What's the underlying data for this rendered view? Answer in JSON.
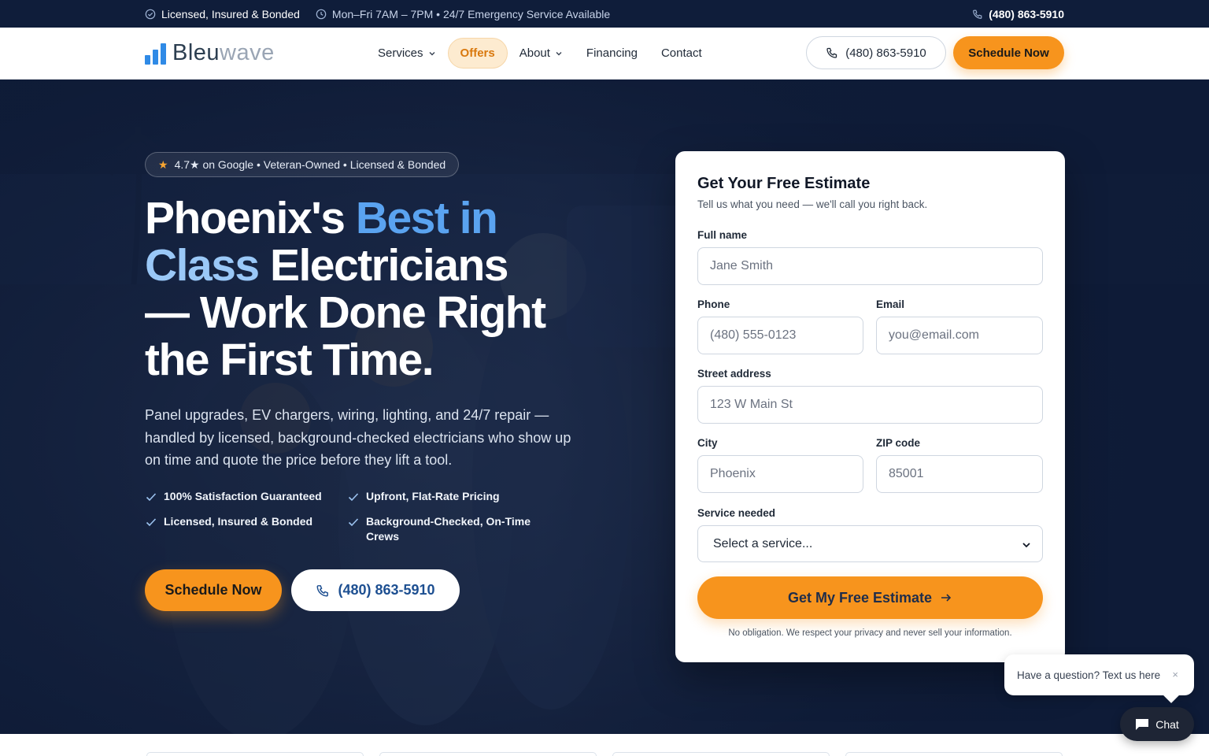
{
  "topbar": {
    "licensed": "Licensed, Insured & Bonded",
    "hours": "Mon–Fri 7AM – 7PM • 24/7 Emergency Service Available",
    "phone": "(480) 863-5910"
  },
  "nav": {
    "logo_main": "Bleu",
    "logo_accent": "wave",
    "links": [
      "Services",
      "Offers",
      "About",
      "Financing",
      "Contact"
    ],
    "phone": "(480) 863-5910",
    "schedule": "Schedule Now"
  },
  "hero": {
    "badge": "4.7★ on Google • Veteran-Owned • Licensed & Bonded",
    "headline_1": "Phoenix's ",
    "headline_best": "Best in",
    "headline_class": "Class",
    "headline_2": " Electricians",
    "headline_3": "— Work Done Right",
    "headline_4": "the First Time.",
    "subtext": "Panel upgrades, EV chargers, wiring, lighting, and 24/7 repair — handled by licensed, background-checked electricians who show up on time and quote the price before they lift a tool.",
    "checks": [
      "100% Satisfaction Guaranteed",
      "Upfront, Flat-Rate Pricing",
      "Licensed, Insured & Bonded",
      "Background-Checked, On-Time Crews"
    ],
    "schedule": "Schedule Now",
    "phone": "(480) 863-5910"
  },
  "form": {
    "title": "Get Your Free Estimate",
    "subtitle": "Tell us what you need — we'll call you right back.",
    "fullname_label": "Full name",
    "fullname_placeholder": "Jane Smith",
    "phone_label": "Phone",
    "phone_placeholder": "(480) 555-0123",
    "email_label": "Email",
    "email_placeholder": "you@email.com",
    "street_label": "Street address",
    "street_placeholder": "123 W Main St",
    "city_label": "City",
    "city_placeholder": "Phoenix",
    "zip_label": "ZIP code",
    "zip_placeholder": "85001",
    "service_label": "Service needed",
    "service_value": "Select a service...",
    "submit": "Get My Free Estimate",
    "disclaimer": "No obligation. We respect your privacy and never sell your information."
  },
  "chat": {
    "bubble": "Have a question? Text us here",
    "close": "×",
    "button": "Chat"
  },
  "colors": {
    "navy": "#0f1d3a",
    "accent_orange": "#f7941d",
    "accent_blue": "#5aa3f0"
  },
  "icons": [
    "check-circle-icon",
    "clock-icon",
    "phone-icon",
    "chevron-down-icon",
    "star-icon",
    "checkmark-icon",
    "arrow-right-icon",
    "chat-icon",
    "close-icon"
  ]
}
